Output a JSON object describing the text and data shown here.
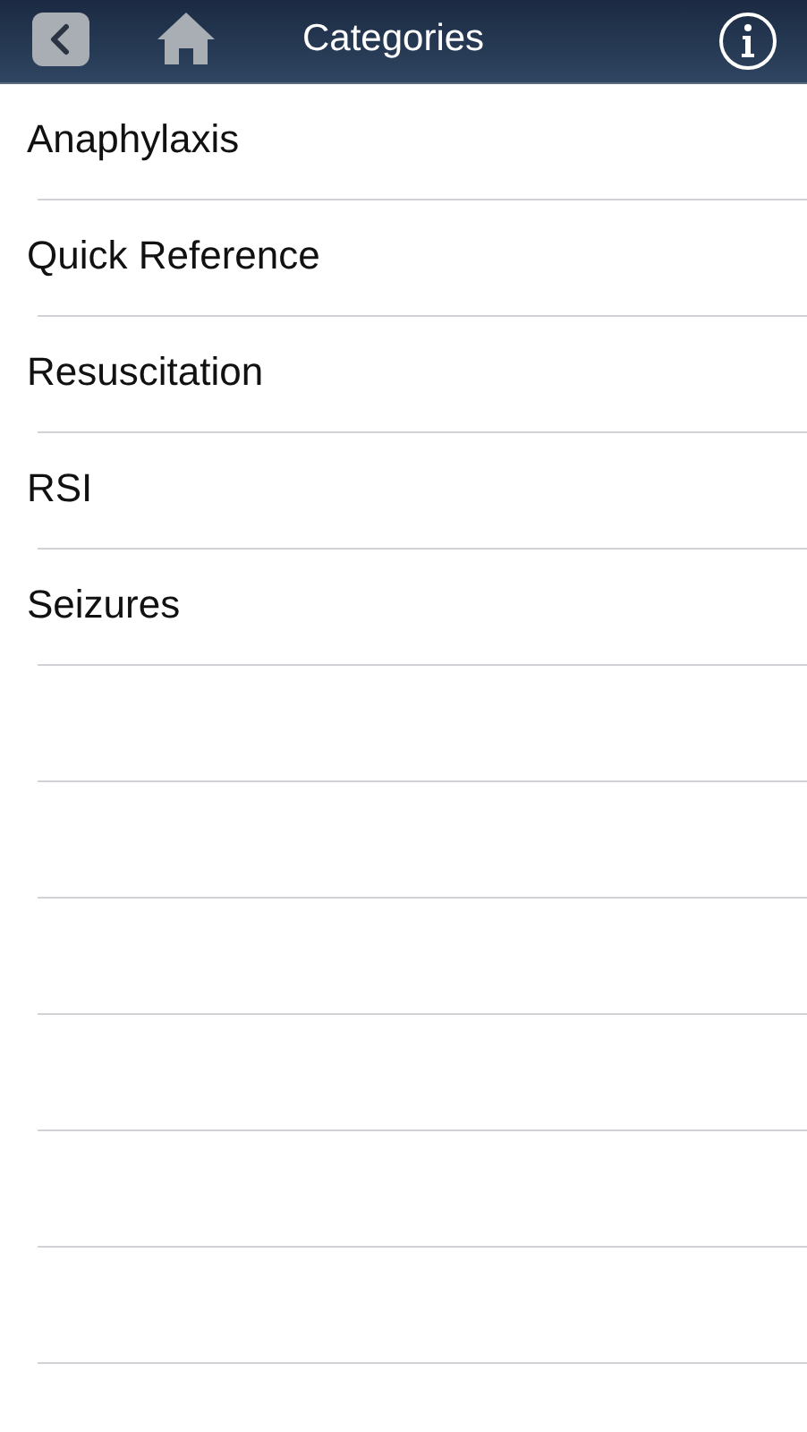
{
  "nav_bar": {
    "title": "Categories"
  },
  "categories": [
    {
      "label": "Anaphylaxis"
    },
    {
      "label": "Quick Reference"
    },
    {
      "label": "Resuscitation"
    },
    {
      "label": "RSI"
    },
    {
      "label": "Seizures"
    }
  ]
}
